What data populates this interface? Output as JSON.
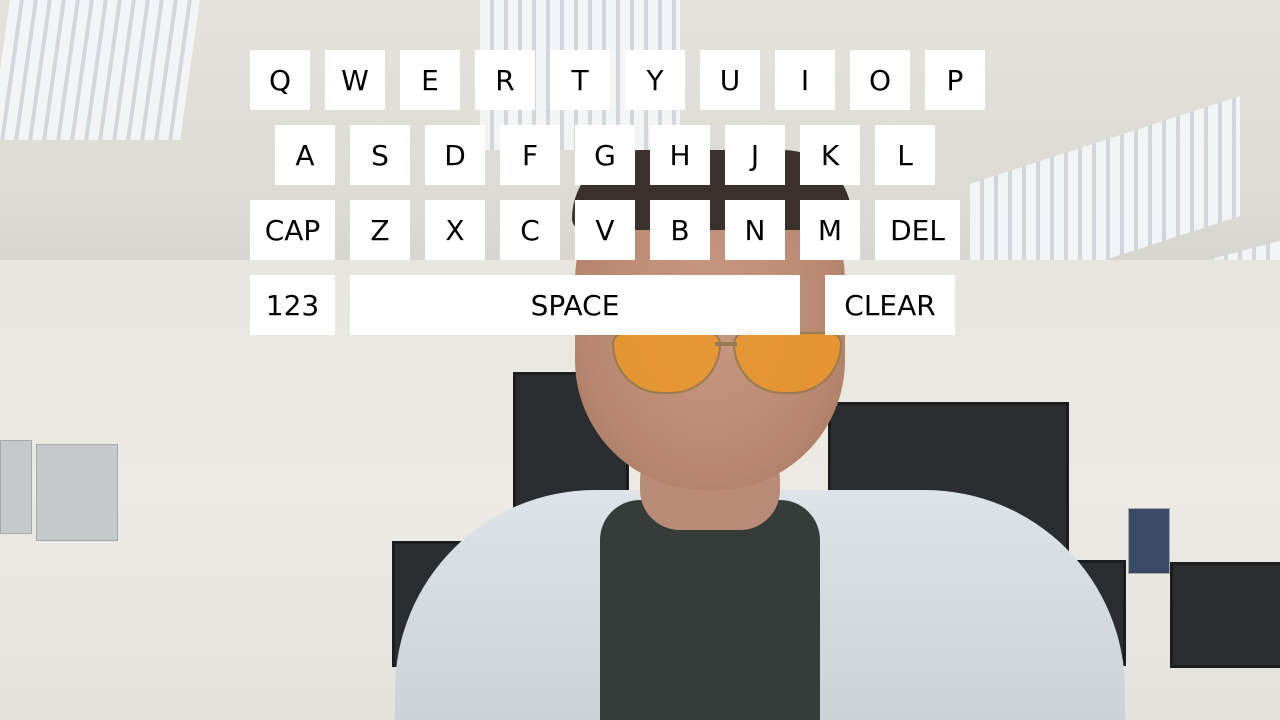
{
  "keyboard": {
    "row1": [
      "Q",
      "W",
      "E",
      "R",
      "T",
      "Y",
      "U",
      "I",
      "O",
      "P"
    ],
    "row2": [
      "A",
      "S",
      "D",
      "F",
      "G",
      "H",
      "J",
      "K",
      "L"
    ],
    "row3": [
      "CAP",
      "Z",
      "X",
      "C",
      "V",
      "B",
      "N",
      "M",
      "DEL"
    ],
    "row4": [
      "123",
      "SPACE",
      "CLEAR"
    ]
  },
  "colors": {
    "key_background": "#ffffff",
    "key_text": "#000000"
  }
}
